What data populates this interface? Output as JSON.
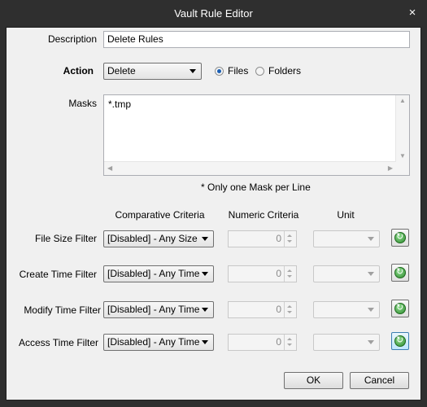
{
  "window": {
    "title": "Vault Rule Editor",
    "close_glyph": "×"
  },
  "description": {
    "label": "Description",
    "value": "Delete Rules"
  },
  "action": {
    "label": "Action",
    "selected": "Delete",
    "files_label": "Files",
    "folders_label": "Folders",
    "selected_target": "Files"
  },
  "masks": {
    "label": "Masks",
    "value": "*.tmp",
    "hint": "* Only one Mask per Line"
  },
  "filters": {
    "headers": {
      "comparative": "Comparative Criteria",
      "numeric": "Numeric Criteria",
      "unit": "Unit"
    },
    "rows": [
      {
        "label": "File Size Filter",
        "criteria": "[Disabled] - Any Size",
        "numeric": "0",
        "unit": ""
      },
      {
        "label": "Create Time Filter",
        "criteria": "[Disabled] - Any Time",
        "numeric": "0",
        "unit": ""
      },
      {
        "label": "Modify Time Filter",
        "criteria": "[Disabled] - Any Time",
        "numeric": "0",
        "unit": ""
      },
      {
        "label": "Access Time Filter",
        "criteria": "[Disabled] - Any Time",
        "numeric": "0",
        "unit": ""
      }
    ]
  },
  "buttons": {
    "ok": "OK",
    "cancel": "Cancel"
  },
  "icons": {
    "reset": "refresh-icon"
  }
}
